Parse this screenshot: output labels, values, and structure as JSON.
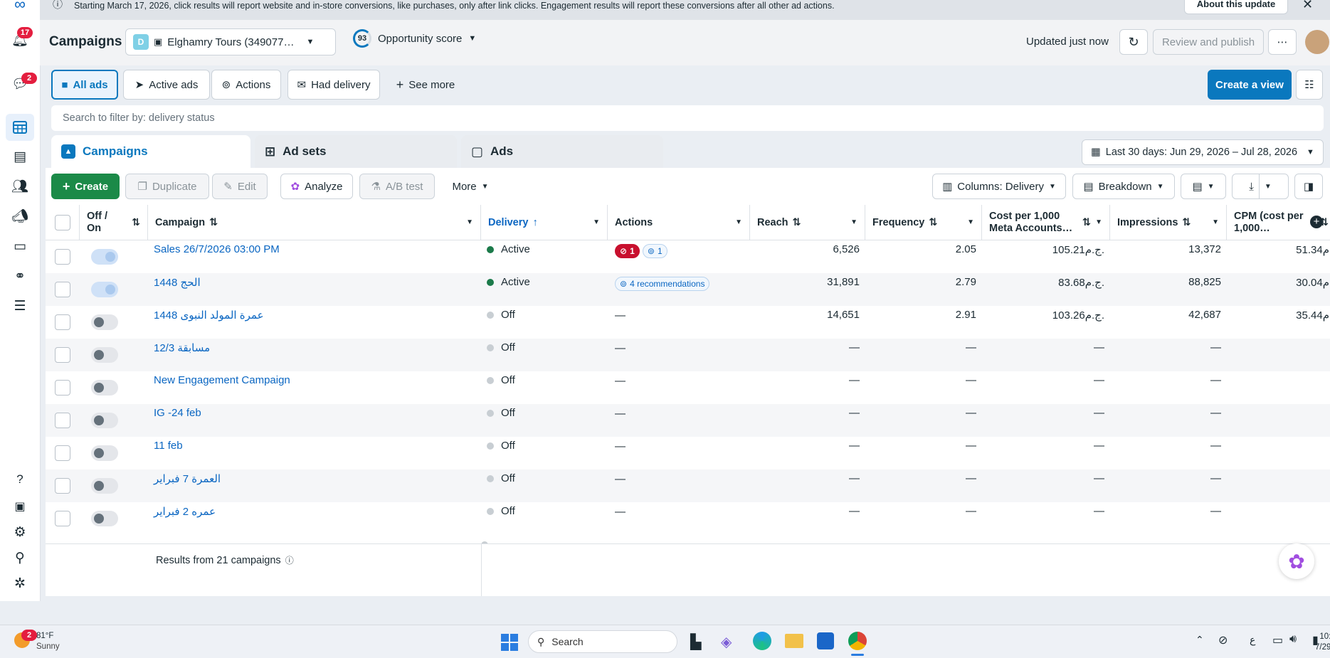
{
  "banner": {
    "text": "Starting March 17, 2026, click results will report website and in-store conversions, like purchases, only after link clicks. Engagement results will report these conversions after all other ad actions.",
    "about_label": "About this update"
  },
  "rail": {
    "notifications_count": "17",
    "messages_count": "2"
  },
  "header": {
    "title": "Campaigns",
    "account_initial": "D",
    "account_name": "Elghamry Tours (349077…",
    "score_value": "93",
    "score_label": "Opportunity score",
    "updated": "Updated just now",
    "review_label": "Review and publish"
  },
  "views": {
    "items": [
      "All ads",
      "Active ads",
      "Actions",
      "Had delivery"
    ],
    "see_more": "See more",
    "create_view": "Create a view"
  },
  "search": {
    "placeholder": "Search to filter by: delivery status"
  },
  "tabs": [
    "Campaigns",
    "Ad sets",
    "Ads"
  ],
  "date_range": "Last 30 days: Jun 29, 2026 – Jul 28, 2026",
  "toolbar": {
    "create": "Create",
    "duplicate": "Duplicate",
    "edit": "Edit",
    "analyze": "Analyze",
    "ab_test": "A/B test",
    "more": "More",
    "columns": "Columns: Delivery",
    "breakdown": "Breakdown"
  },
  "table": {
    "headers": {
      "toggle": "Off / On",
      "campaign": "Campaign",
      "delivery": "Delivery",
      "actions": "Actions",
      "reach": "Reach",
      "frequency": "Frequency",
      "cost": "Cost per 1,000 Meta Accounts…",
      "impressions": "Impressions",
      "cpm": "CPM (cost per 1,000…"
    },
    "rows": [
      {
        "name": "Sales 26/7/2026 03:00 PM",
        "on": true,
        "delivery": "Active",
        "actions": {
          "errors": "1",
          "recs": "1"
        },
        "reach": "6,526",
        "frequency": "2.05",
        "cost": "105.21ج.م.",
        "impressions": "13,372",
        "cpm": "51.34ج.م."
      },
      {
        "name": "الحج 1448",
        "on": true,
        "delivery": "Active",
        "actions": {
          "recs_label": "4 recommendations"
        },
        "reach": "31,891",
        "frequency": "2.79",
        "cost": "83.68ج.م.",
        "impressions": "88,825",
        "cpm": "30.04ج.م."
      },
      {
        "name": "عمرة المولد النبوى 1448",
        "on": false,
        "delivery": "Off",
        "actions_text": "—",
        "reach": "14,651",
        "frequency": "2.91",
        "cost": "103.26ج.م.",
        "impressions": "42,687",
        "cpm": "35.44ج.م."
      },
      {
        "name": "مسابقة 12/3",
        "on": false,
        "delivery": "Off",
        "actions_text": "—",
        "reach": "—",
        "frequency": "—",
        "cost": "—",
        "impressions": "—",
        "cpm": "—"
      },
      {
        "name": "New Engagement Campaign",
        "on": false,
        "delivery": "Off",
        "actions_text": "—",
        "reach": "—",
        "frequency": "—",
        "cost": "—",
        "impressions": "—",
        "cpm": "—"
      },
      {
        "name": "IG -24 feb",
        "on": false,
        "delivery": "Off",
        "actions_text": "—",
        "reach": "—",
        "frequency": "—",
        "cost": "—",
        "impressions": "—",
        "cpm": "—"
      },
      {
        "name": "11 feb",
        "on": false,
        "delivery": "Off",
        "actions_text": "—",
        "reach": "—",
        "frequency": "—",
        "cost": "—",
        "impressions": "—",
        "cpm": "—"
      },
      {
        "name": "العمرة 7 فبراير",
        "on": false,
        "delivery": "Off",
        "actions_text": "—",
        "reach": "—",
        "frequency": "—",
        "cost": "—",
        "impressions": "—",
        "cpm": "—"
      },
      {
        "name": "عمره 2 فبراير",
        "on": false,
        "delivery": "Off",
        "actions_text": "—",
        "reach": "—",
        "frequency": "—",
        "cost": "—",
        "impressions": "—",
        "cpm": "—"
      }
    ],
    "footer": "Results from 21 campaigns"
  },
  "taskbar": {
    "weather_temp": "81°F",
    "weather_desc": "Sunny",
    "weather_badge": "2",
    "search": "Search",
    "lang": "ع",
    "time": "10:",
    "date": "7/29"
  },
  "colors": {
    "accent": "#0a78be",
    "green": "#1b8a48",
    "active": "#1b7a4a",
    "off": "#c8ced3",
    "error": "#c8102e"
  }
}
